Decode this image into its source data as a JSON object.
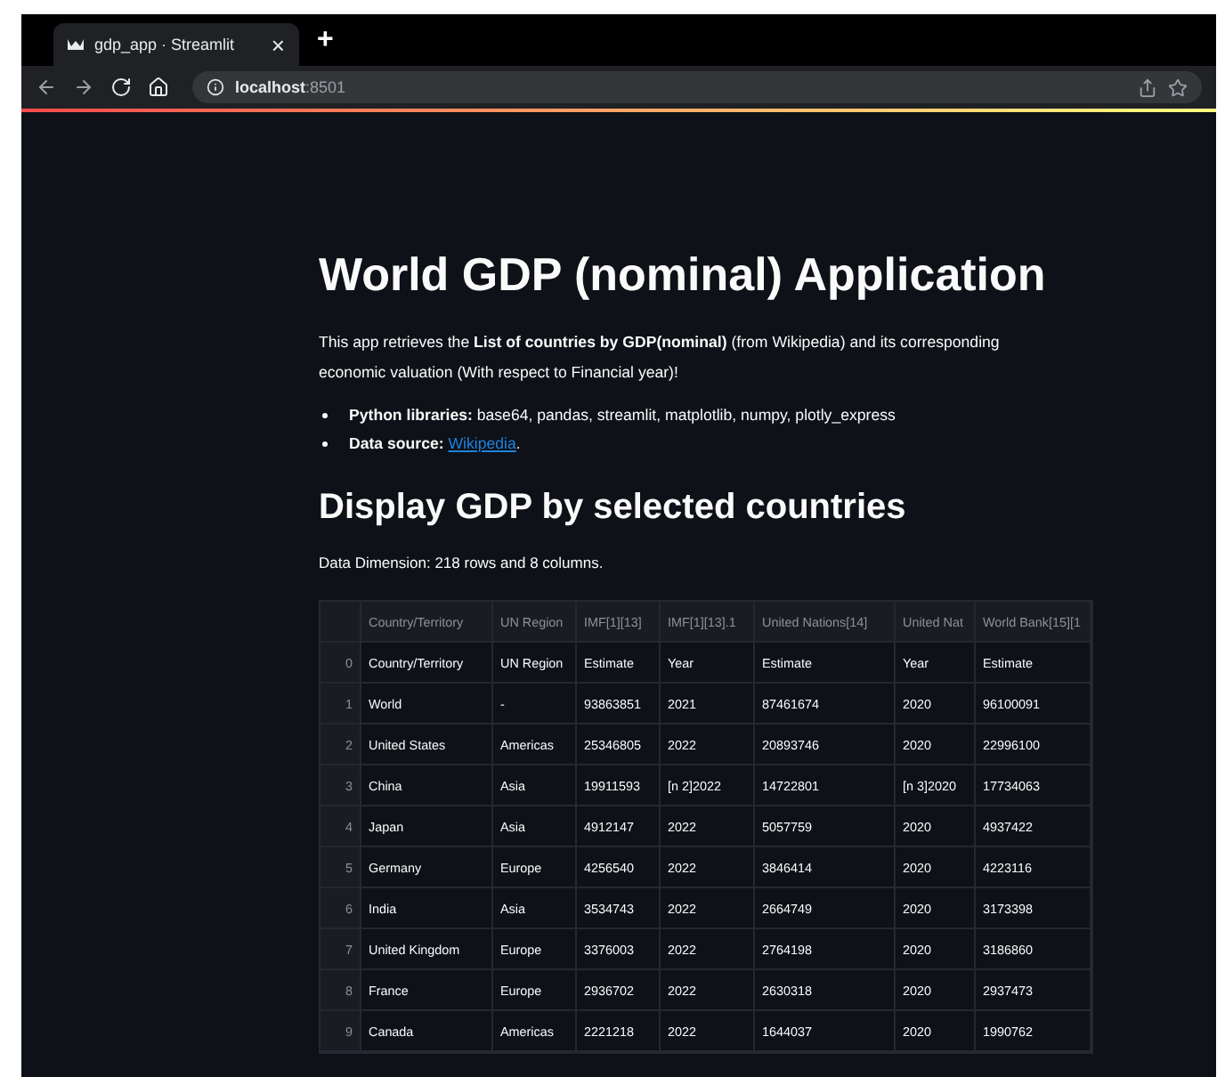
{
  "browser": {
    "tab": {
      "title": "gdp_app · Streamlit",
      "close": "×"
    },
    "new_tab": "+",
    "address": {
      "host": "localhost",
      "port": ":8501"
    }
  },
  "app": {
    "title": "World GDP (nominal) Application",
    "intro": "This app retrieves the **List of countries by GDP(nominal)** (from Wikipedia) and its corresponding economic valuation (With respect to Financial year)!",
    "bullets": [
      {
        "label": "Python libraries:",
        "text": "base64, pandas, streamlit, matplotlib, numpy, plotly_express"
      },
      {
        "label": "Data source:",
        "link": "Wikipedia",
        "text": "."
      }
    ],
    "section_title": "Display GDP by selected countries",
    "dimension": "Data Dimension: 218 rows and 8 columns.",
    "table": {
      "columns": [
        "Country/Territory",
        "UN Region",
        "IMF[1][13]",
        "IMF[1][13].1",
        "United Nations[14]",
        "United Nat",
        "World Bank[15][1"
      ],
      "rows": [
        {
          "index": "0",
          "cells": [
            "Country/Territory",
            "UN Region",
            "Estimate",
            "Year",
            "Estimate",
            "Year",
            "Estimate"
          ]
        },
        {
          "index": "1",
          "cells": [
            "World",
            "-",
            "93863851",
            "2021",
            "87461674",
            "2020",
            "96100091"
          ]
        },
        {
          "index": "2",
          "cells": [
            "United States",
            "Americas",
            "25346805",
            "2022",
            "20893746",
            "2020",
            "22996100"
          ]
        },
        {
          "index": "3",
          "cells": [
            "China",
            "Asia",
            "19911593",
            "[n 2]2022",
            "14722801",
            "[n 3]2020",
            "17734063"
          ]
        },
        {
          "index": "4",
          "cells": [
            "Japan",
            "Asia",
            "4912147",
            "2022",
            "5057759",
            "2020",
            "4937422"
          ]
        },
        {
          "index": "5",
          "cells": [
            "Germany",
            "Europe",
            "4256540",
            "2022",
            "3846414",
            "2020",
            "4223116"
          ]
        },
        {
          "index": "6",
          "cells": [
            "India",
            "Asia",
            "3534743",
            "2022",
            "2664749",
            "2020",
            "3173398"
          ]
        },
        {
          "index": "7",
          "cells": [
            "United Kingdom",
            "Europe",
            "3376003",
            "2022",
            "2764198",
            "2020",
            "3186860"
          ]
        },
        {
          "index": "8",
          "cells": [
            "France",
            "Europe",
            "2936702",
            "2022",
            "2630318",
            "2020",
            "2937473"
          ]
        },
        {
          "index": "9",
          "cells": [
            "Canada",
            "Americas",
            "2221218",
            "2022",
            "1644037",
            "2020",
            "1990762"
          ]
        }
      ]
    }
  }
}
